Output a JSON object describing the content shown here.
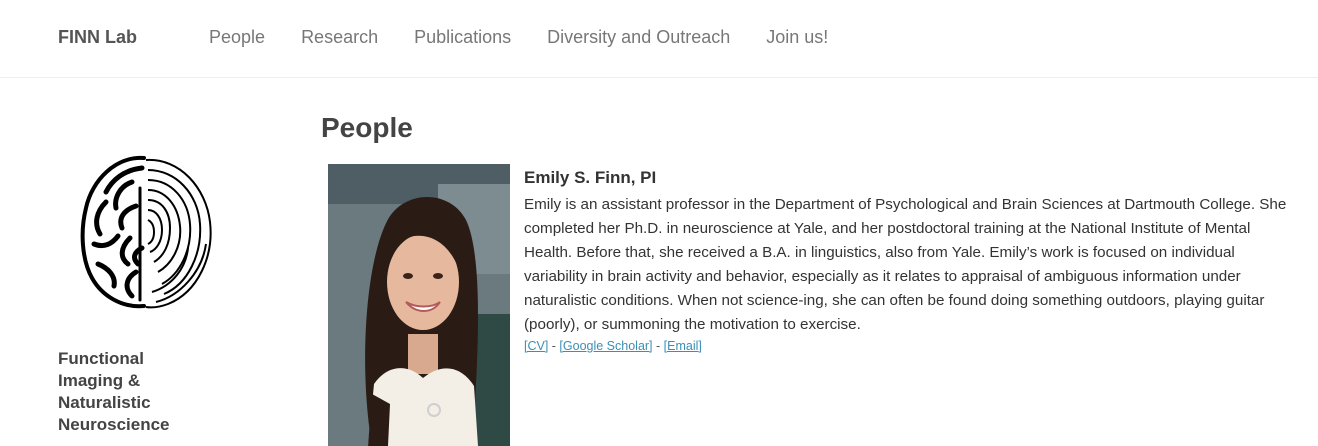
{
  "nav": {
    "brand": "FINN Lab",
    "items": [
      {
        "label": "People"
      },
      {
        "label": "Research"
      },
      {
        "label": "Publications"
      },
      {
        "label": "Diversity and Outreach"
      },
      {
        "label": "Join us!"
      }
    ]
  },
  "sidebar": {
    "logo_icon": "brain-fingerprint-logo-icon",
    "lab_name_lines": [
      "Functional",
      "Imaging &",
      "Naturalistic",
      "Neuroscience"
    ]
  },
  "main": {
    "title": "People",
    "people": [
      {
        "name": "Emily S. Finn, PI",
        "bio": "Emily is an assistant professor in the Department of Psychological and Brain Sciences at Dartmouth College. She completed her Ph.D. in neuroscience at Yale, and her postdoctoral training at the National Institute of Mental Health. Before that, she received a B.A. in linguistics, also from Yale. Emily’s work is focused on individual variability in brain activity and behavior, especially as it relates to appraisal of ambiguous information under naturalistic conditions. When not science-ing, she can often be found doing something outdoors, playing guitar (poorly), or summoning the motivation to exercise.",
        "links": {
          "cv": "[CV]",
          "scholar": "[Google Scholar]",
          "email": "[Email]",
          "separator": " - "
        }
      }
    ]
  },
  "colors": {
    "nav_text": "#777777",
    "brand_text": "#555555",
    "heading_text": "#444444",
    "body_text": "#333333",
    "link": "#3a8fb7"
  }
}
